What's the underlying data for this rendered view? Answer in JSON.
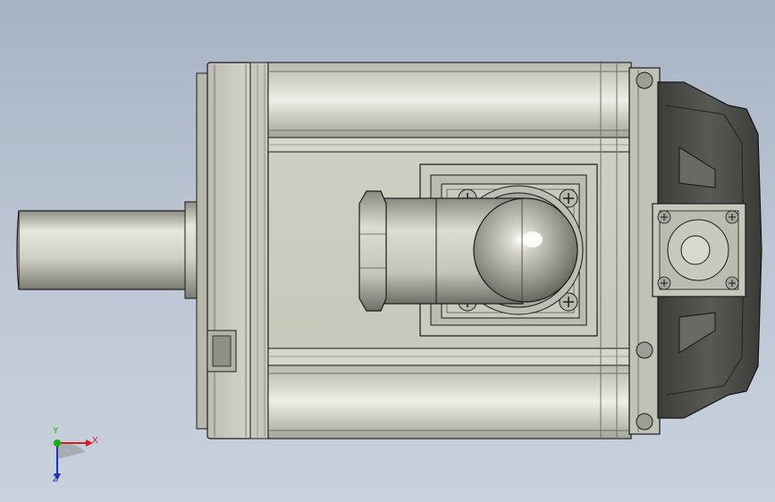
{
  "viewport": {
    "background_top": "#a7b3c4",
    "background_bottom": "#c9d1de"
  },
  "model": {
    "description_icon": "servo-motor-model",
    "body_color": "#c9c9bd",
    "dark_plastic_color": "#4a4a46",
    "outline_color": "#1a1a1a"
  },
  "triad": {
    "x_label": "X",
    "y_label": "Y",
    "z_label": "Z",
    "x_color": "#d02020",
    "y_color": "#18b018",
    "z_color": "#2030c0"
  }
}
